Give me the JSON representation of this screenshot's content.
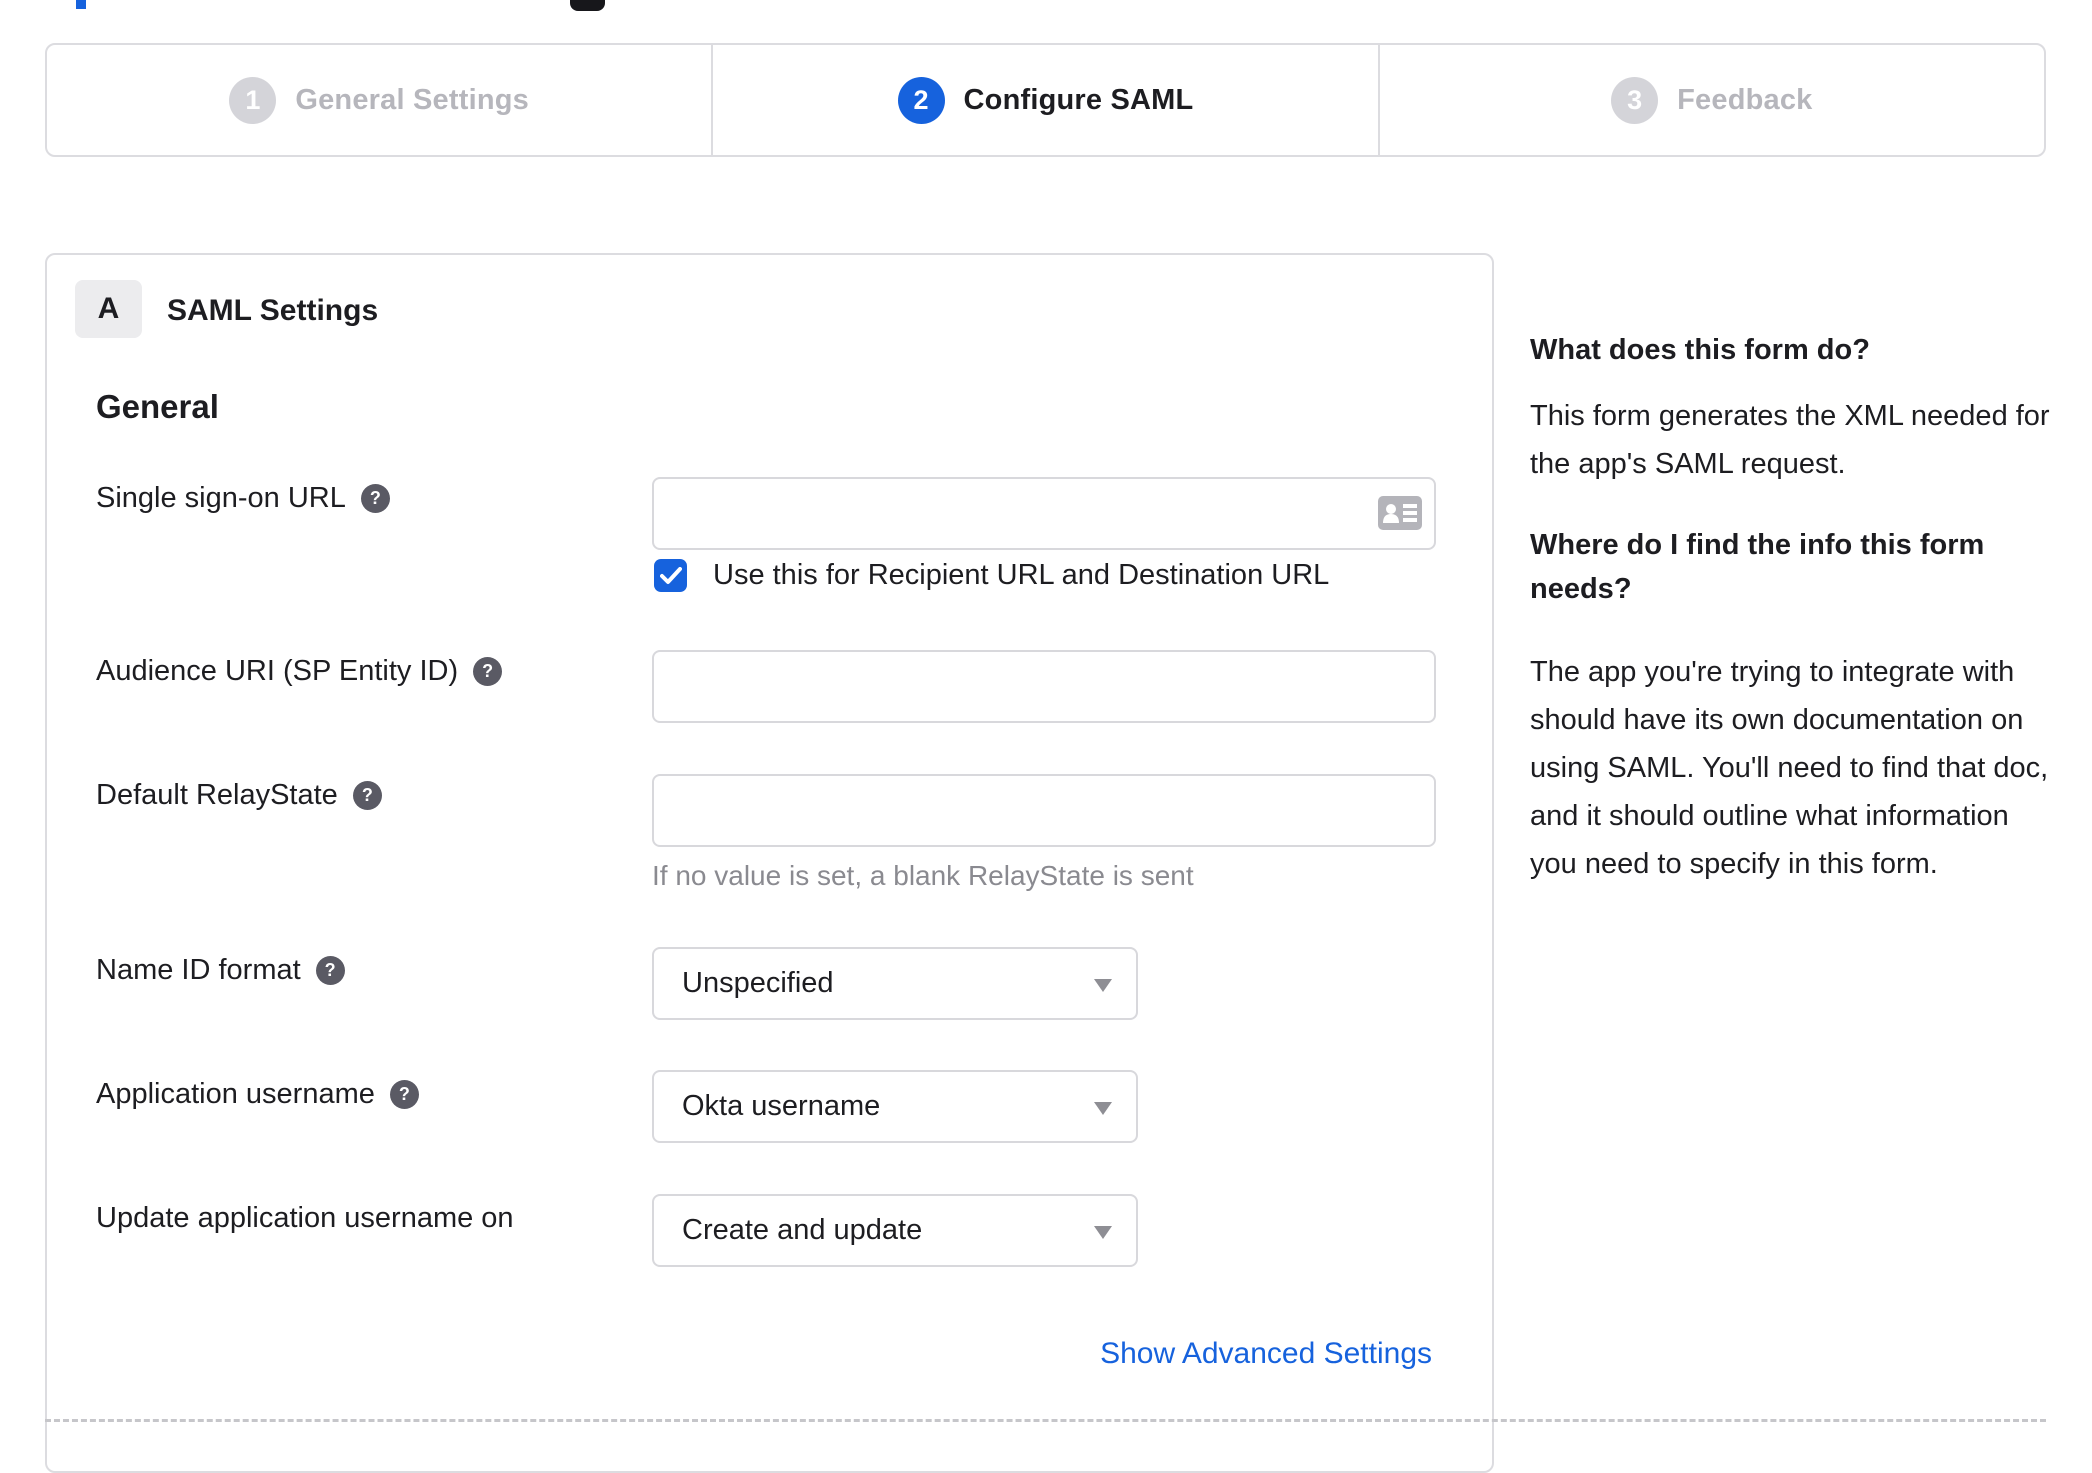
{
  "stepper": {
    "steps": [
      {
        "number": "1",
        "label": "General Settings",
        "state": "inactive"
      },
      {
        "number": "2",
        "label": "Configure SAML",
        "state": "active"
      },
      {
        "number": "3",
        "label": "Feedback",
        "state": "inactive"
      }
    ]
  },
  "form": {
    "section_badge": "A",
    "section_title": "SAML Settings",
    "group_heading": "General",
    "fields": {
      "sso_url": {
        "label": "Single sign-on URL",
        "value": "",
        "checkbox_label": "Use this for Recipient URL and Destination URL",
        "checkbox_checked": true
      },
      "audience_uri": {
        "label": "Audience URI (SP Entity ID)",
        "value": ""
      },
      "default_relay_state": {
        "label": "Default RelayState",
        "value": "",
        "hint": "If no value is set, a blank RelayState is sent"
      },
      "name_id_format": {
        "label": "Name ID format",
        "value": "Unspecified"
      },
      "application_username": {
        "label": "Application username",
        "value": "Okta username"
      },
      "update_application_username_on": {
        "label": "Update application username on",
        "value": "Create and update"
      }
    },
    "advanced_link": "Show Advanced Settings"
  },
  "help_panel": {
    "sections": [
      {
        "heading": "What does this form do?",
        "body": "This form generates the XML needed for the app's SAML request."
      },
      {
        "heading": "Where do I find the info this form needs?",
        "body": "The app you're trying to integrate with should have its own documentation on using SAML. You'll need to find that doc, and it should outline what information you need to specify in this form."
      }
    ]
  },
  "colors": {
    "accent_blue": "#1662dd",
    "text_dark": "#1d1d21",
    "inactive_step_circle": "#d4d4d9",
    "inactive_step_label": "#b6b6bc",
    "border_gray": "#dcdce0",
    "hint_gray": "#8a8a90",
    "help_icon_gray": "#5a5a64"
  }
}
